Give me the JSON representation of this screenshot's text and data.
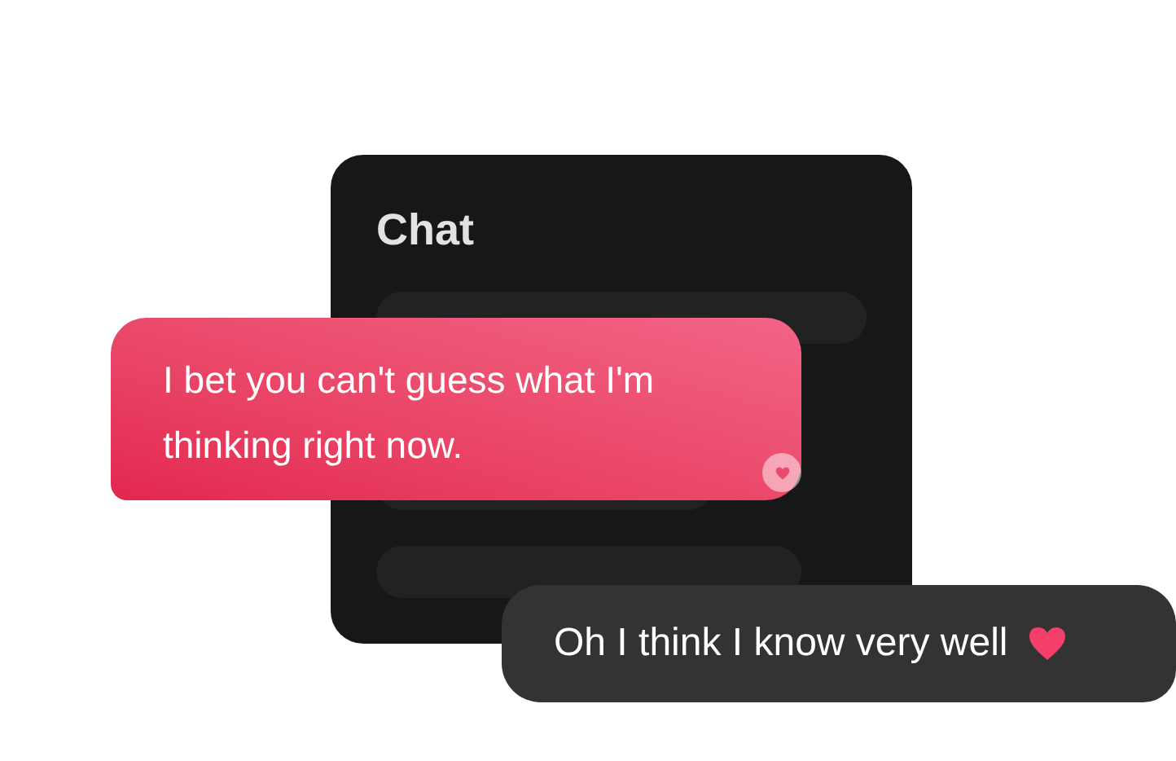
{
  "chat_panel": {
    "title": "Chat"
  },
  "messages": [
    {
      "kind": "incoming",
      "text": "I bet you can't guess what I'm thinking right now.",
      "reaction": true
    },
    {
      "kind": "outgoing",
      "text": "Oh I think I know very well",
      "heart": true
    }
  ]
}
